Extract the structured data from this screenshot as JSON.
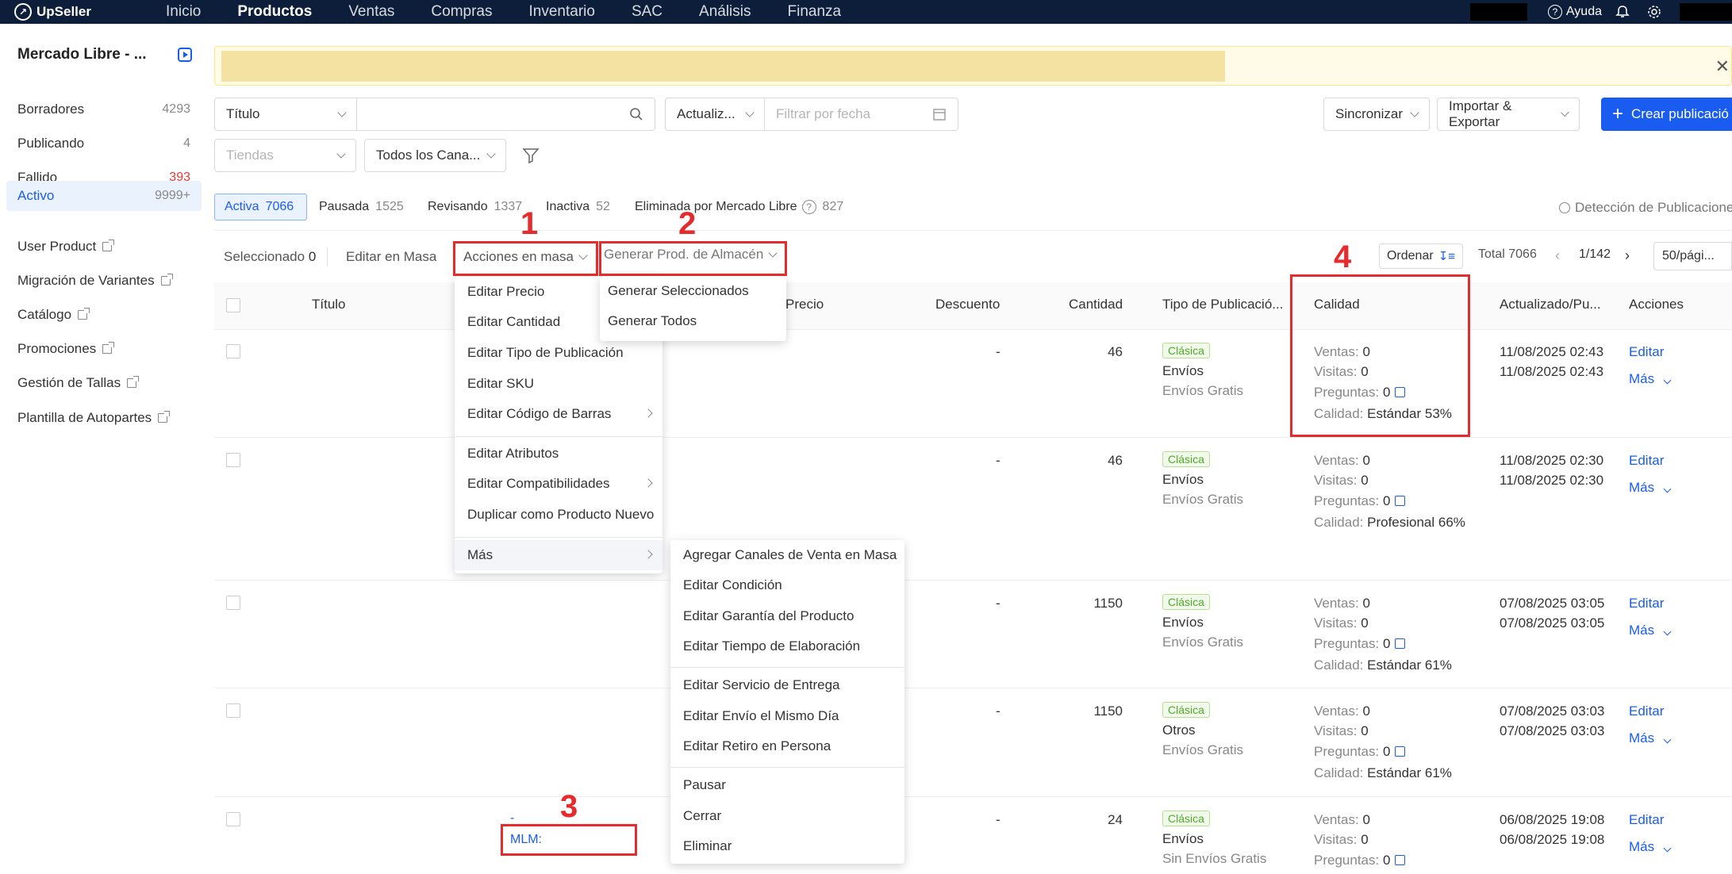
{
  "brand": {
    "name": "UpSeller"
  },
  "nav": {
    "items": [
      "Inicio",
      "Productos",
      "Ventas",
      "Compras",
      "Inventario",
      "SAC",
      "Análisis",
      "Finanza"
    ],
    "help": "Ayuda"
  },
  "sidebar": {
    "store": "Mercado Libre - ...",
    "statuses": [
      {
        "label": "Borradores",
        "count": "4293"
      },
      {
        "label": "Publicando",
        "count": "4"
      },
      {
        "label": "Fallido",
        "count": "393"
      },
      {
        "label": "Activo",
        "count": "9999+"
      }
    ],
    "links": [
      "User Product",
      "Migración de Variantes",
      "Catálogo",
      "Promociones",
      "Gestión de Tallas",
      "Plantilla de Autopartes"
    ]
  },
  "filters": {
    "field_select": "Título",
    "date_select": "Actualiz...",
    "date_placeholder": "Filtrar por fecha",
    "stores_placeholder": "Tiendas",
    "channels": "Todos los Cana...",
    "sync": "Sincronizar",
    "import_export": "Importar & Exportar",
    "create": "Crear publicació"
  },
  "tabs": [
    {
      "label": "Activa",
      "count": "7066"
    },
    {
      "label": "Pausada",
      "count": "1525"
    },
    {
      "label": "Revisando",
      "count": "1337"
    },
    {
      "label": "Inactiva",
      "count": "52"
    },
    {
      "label": "Eliminada por Mercado Libre",
      "count": "827"
    }
  ],
  "detection": "Detección de Publicacione",
  "toolbar": {
    "selected_label": "Seleccionado",
    "selected_count": "0",
    "edit_mass": "Editar en Masa",
    "bulk_actions": "Acciones en masa",
    "generate": "Generar Prod. de Almacén",
    "sort": "Ordenar",
    "total": "Total 7066",
    "page": "1/142",
    "per_page": "50/pági..."
  },
  "columns": [
    "Título",
    "Precio",
    "Descuento",
    "Cantidad",
    "Tipo de Publicació...",
    "Calidad",
    "Actualizado/Pu...",
    "Acciones"
  ],
  "rows": [
    {
      "discount": "-",
      "qty": "46",
      "type": "Clásica",
      "ship1": "Envíos",
      "ship2": "Envíos Gratis",
      "ventas": "0",
      "visitas": "0",
      "preguntas": "0",
      "calidad": "Estándar 53%",
      "d1": "11/08/2025 02:43",
      "d2": "11/08/2025 02:43"
    },
    {
      "discount": "-",
      "qty": "46",
      "type": "Clásica",
      "ship1": "Envíos",
      "ship2": "Envíos Gratis",
      "ventas": "0",
      "visitas": "0",
      "preguntas": "0",
      "calidad": "Profesional 66%",
      "d1": "11/08/2025 02:30",
      "d2": "11/08/2025 02:30"
    },
    {
      "discount": "-",
      "qty": "1150",
      "type": "Clásica",
      "ship1": "Envíos",
      "ship2": "Envíos Gratis",
      "ventas": "0",
      "visitas": "0",
      "preguntas": "0",
      "calidad": "Estándar 61%",
      "d1": "07/08/2025 03:05",
      "d2": "07/08/2025 03:05"
    },
    {
      "discount": "-",
      "qty": "1150",
      "type": "Clásica",
      "ship1": "Otros",
      "ship2": "Envíos Gratis",
      "ventas": "0",
      "visitas": "0",
      "preguntas": "0",
      "calidad": "Estándar 61%",
      "d1": "07/08/2025 03:03",
      "d2": "07/08/2025 03:03"
    },
    {
      "discount": "-",
      "qty": "24",
      "type": "Clásica",
      "ship1": "Envíos",
      "ship2": "Sin Envíos Gratis",
      "ventas": "0",
      "visitas": "0",
      "preguntas": "0",
      "calidad": "",
      "d1": "06/08/2025 19:08",
      "d2": "06/08/2025 19:08"
    }
  ],
  "labels": {
    "ventas": "Ventas:",
    "visitas": "Visitas:",
    "preguntas": "Preguntas:",
    "calidad": "Calidad:",
    "edit": "Editar",
    "more": "Más",
    "sku": "MLM:",
    "dash": "-"
  },
  "bulk_menu": [
    "Editar Precio",
    "Editar Cantidad",
    "Editar Tipo de Publicación",
    "Editar SKU",
    "Editar Código de Barras",
    "Editar Atributos",
    "Editar Compatibilidades",
    "Duplicar como Producto Nuevo",
    "Más"
  ],
  "generate_menu": [
    "Generar Seleccionados",
    "Generar Todos"
  ],
  "more_menu": [
    "Agregar Canales de Venta en Masa",
    "Editar Condición",
    "Editar Garantía del Producto",
    "Editar Tiempo de Elaboración",
    "Editar Servicio de Entrega",
    "Editar Envío el Mismo Día",
    "Editar Retiro en Persona",
    "Pausar",
    "Cerrar",
    "Eliminar"
  ],
  "annotations": [
    "1",
    "2",
    "3",
    "4"
  ],
  "colors": {
    "nav_bg": "#0d1e3a",
    "primary": "#1a5cf0",
    "annotation": "#e52b2b",
    "danger_count": "#e53935"
  }
}
